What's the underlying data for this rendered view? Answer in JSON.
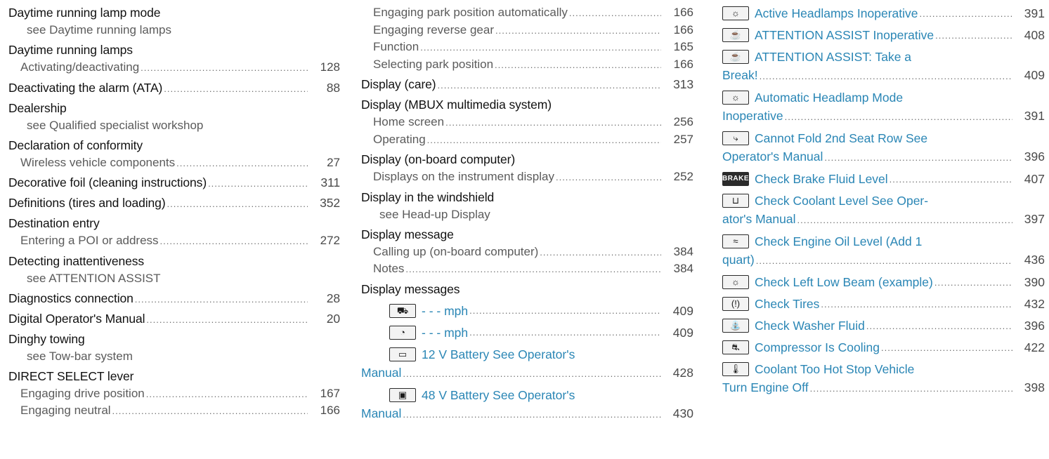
{
  "column1": [
    {
      "heading": "Daytime running lamp mode",
      "see": "see Daytime running lamps"
    },
    {
      "heading": "Daytime running lamps",
      "subs": [
        {
          "label": "Activating/deactivating",
          "page": "128"
        }
      ]
    },
    {
      "heading": "Deactivating the alarm (ATA)",
      "page": "88"
    },
    {
      "heading": "Dealership",
      "see": "see Qualified specialist workshop"
    },
    {
      "heading": "Declaration of conformity",
      "subs": [
        {
          "label": "Wireless vehicle components",
          "page": "27"
        }
      ]
    },
    {
      "heading": "Decorative foil (cleaning instructions)",
      "page": "311"
    },
    {
      "heading": "Definitions (tires and loading)",
      "page": "352"
    },
    {
      "heading": "Destination entry",
      "subs": [
        {
          "label": "Entering a POI or address",
          "page": "272"
        }
      ]
    },
    {
      "heading": "Detecting inattentiveness",
      "see": "see ATTENTION ASSIST"
    },
    {
      "heading": "Diagnostics connection",
      "page": "28"
    },
    {
      "heading": "Digital Operator's Manual",
      "page": "20"
    },
    {
      "heading": "Dinghy towing",
      "see": "see Tow-bar system"
    },
    {
      "heading": "DIRECT SELECT lever",
      "subs": [
        {
          "label": "Engaging drive position",
          "page": "167"
        },
        {
          "label": "Engaging neutral",
          "page": "166"
        }
      ]
    }
  ],
  "column2": {
    "continued": [
      {
        "label": "Engaging park position automatically",
        "page": "166"
      },
      {
        "label": "Engaging reverse gear",
        "page": "166"
      },
      {
        "label": "Function",
        "page": "165"
      },
      {
        "label": "Selecting park position",
        "page": "166"
      }
    ],
    "entries": [
      {
        "heading": "Display (care)",
        "page": "313"
      },
      {
        "heading": "Display (MBUX multimedia system)",
        "subs": [
          {
            "label": "Home screen",
            "page": "256"
          },
          {
            "label": "Operating",
            "page": "257"
          }
        ]
      },
      {
        "heading": "Display (on-board computer)",
        "subs": [
          {
            "label": "Displays on the instrument display",
            "page": "252"
          }
        ]
      },
      {
        "heading": "Display in the windshield",
        "see": "see Head-up Display"
      },
      {
        "heading": "Display message",
        "subs": [
          {
            "label": "Calling up (on-board computer)",
            "page": "384"
          },
          {
            "label": "Notes",
            "page": "384"
          }
        ]
      }
    ],
    "messages_heading": "Display messages",
    "messages": [
      {
        "icon": "speed-limit-warning-icon",
        "glyph": "⛟",
        "line1": "- - - mph",
        "page": "409"
      },
      {
        "icon": "speedometer-icon",
        "glyph": "◔",
        "line1": "- - - mph",
        "page": "409"
      },
      {
        "icon": "12v-battery-icon",
        "glyph": "▭",
        "line1": "12 V Battery See Operator's",
        "line2": "Manual",
        "page": "428"
      },
      {
        "icon": "48v-battery-icon",
        "glyph": "▣",
        "line1": "48 V Battery See Operator's",
        "line2": "Manual",
        "page": "430"
      }
    ]
  },
  "column3": [
    {
      "icon": "headlamp-sun-icon",
      "glyph": "☼",
      "line1": "Active Headlamps Inoperative",
      "page": "391"
    },
    {
      "icon": "coffee-cup-icon",
      "glyph": "☕",
      "line1": "ATTENTION ASSIST Inoperative",
      "page": "408"
    },
    {
      "icon": "coffee-cup-icon",
      "glyph": "☕",
      "line1": "ATTENTION ASSIST: Take a",
      "line2": "Break!",
      "page": "409"
    },
    {
      "icon": "headlamp-sun-icon",
      "glyph": "☼",
      "line1": "Automatic Headlamp Mode",
      "line2": "Inoperative",
      "page": "391"
    },
    {
      "icon": "seat-fold-icon",
      "glyph": "⤷",
      "line1": "Cannot Fold 2nd Seat Row See",
      "line2": "Operator's Manual",
      "page": "396"
    },
    {
      "icon": "brake-text-icon",
      "glyph": "BRAKE",
      "dark": true,
      "line1": "Check Brake Fluid Level",
      "page": "407"
    },
    {
      "icon": "coolant-level-icon",
      "glyph": "⊔",
      "line1": "Check Coolant Level See Oper-",
      "line2": "ator's Manual",
      "page": "397"
    },
    {
      "icon": "oil-can-icon",
      "glyph": "≈",
      "line1": "Check Engine Oil Level (Add 1",
      "line2": "quart)",
      "page": "436"
    },
    {
      "icon": "headlamp-sun-icon",
      "glyph": "☼",
      "line1": "Check Left Low Beam (example)",
      "page": "390"
    },
    {
      "icon": "tire-pressure-icon",
      "glyph": "(!)",
      "line1": "Check Tires",
      "page": "432"
    },
    {
      "icon": "washer-fluid-icon",
      "glyph": "⛲",
      "line1": "Check Washer Fluid",
      "page": "396"
    },
    {
      "icon": "compressor-car-icon",
      "glyph": "⛐",
      "line1": "Compressor Is Cooling",
      "page": "422"
    },
    {
      "icon": "coolant-temp-icon",
      "glyph": "🌡",
      "line1": "Coolant Too Hot Stop Vehicle",
      "line2": "Turn Engine Off",
      "page": "398"
    }
  ]
}
